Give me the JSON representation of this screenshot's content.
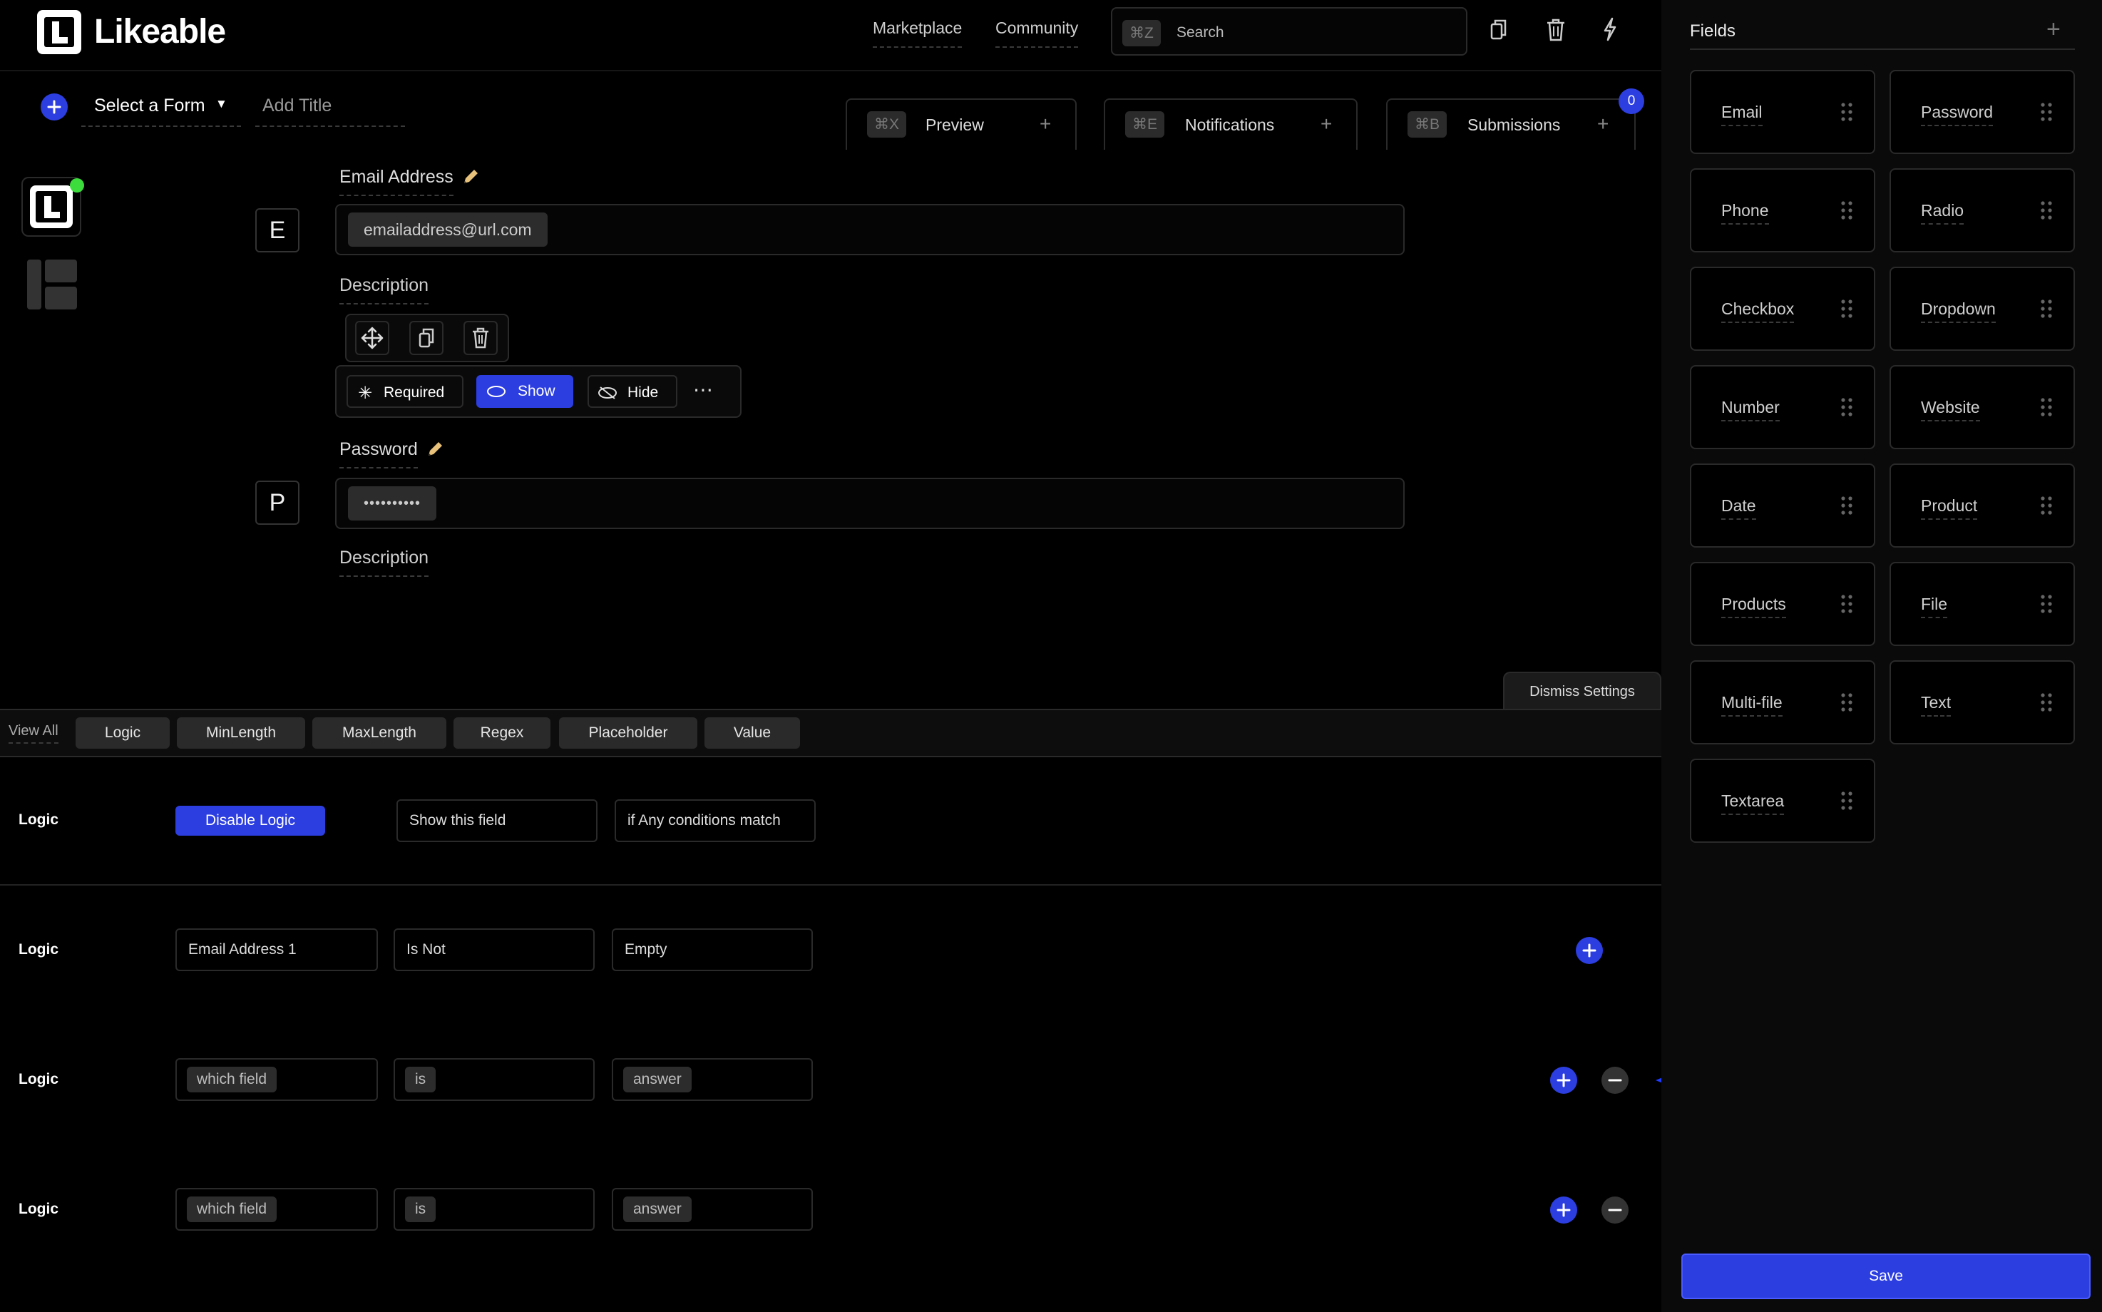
{
  "app": {
    "name": "Likeable",
    "logo_letter": "L"
  },
  "header": {
    "marketplace": "Marketplace",
    "community": "Community",
    "search_shortcut": "⌘Z",
    "search_placeholder": "Search"
  },
  "toolbar": {
    "select_form": "Select a Form",
    "add_title": "Add Title",
    "tabs": [
      {
        "shortcut": "⌘X",
        "label": "Preview"
      },
      {
        "shortcut": "⌘E",
        "label": "Notifications"
      },
      {
        "shortcut": "⌘B",
        "label": "Submissions",
        "badge": "0"
      }
    ]
  },
  "form": {
    "fields": [
      {
        "letter": "E",
        "label": "Email Address",
        "value": "emailaddress@url.com",
        "description": "Description"
      },
      {
        "letter": "P",
        "label": "Password",
        "value": "••••••••••",
        "description": "Description"
      }
    ],
    "field_controls": {
      "required": "Required",
      "show": "Show",
      "hide": "Hide"
    }
  },
  "settings": {
    "dismiss": "Dismiss Settings",
    "view_all": "View All",
    "tabs": [
      "Logic",
      "MinLength",
      "MaxLength",
      "Regex",
      "Placeholder",
      "Value"
    ],
    "logic_rows": [
      {
        "label": "Logic",
        "button": "Disable Logic",
        "a": "Show this field",
        "b": "if Any conditions match"
      },
      {
        "label": "Logic",
        "a": "Email Address 1",
        "b": "Is Not",
        "c": "Empty"
      },
      {
        "label": "Logic",
        "a": "which field",
        "b": "is",
        "c": "answer"
      },
      {
        "label": "Logic",
        "a": "which field",
        "b": "is",
        "c": "answer"
      }
    ]
  },
  "fields_panel": {
    "title": "Fields",
    "items": [
      "Email",
      "Password",
      "Phone",
      "Radio",
      "Checkbox",
      "Dropdown",
      "Number",
      "Website",
      "Date",
      "Product",
      "Products",
      "File",
      "Multi-file",
      "Text",
      "Textarea"
    ],
    "save": "Save"
  },
  "colors": {
    "accent": "#2c3ee0",
    "online": "#3ddc3d",
    "pencil": "#e8c27a",
    "arrow": "#1f3bff"
  }
}
